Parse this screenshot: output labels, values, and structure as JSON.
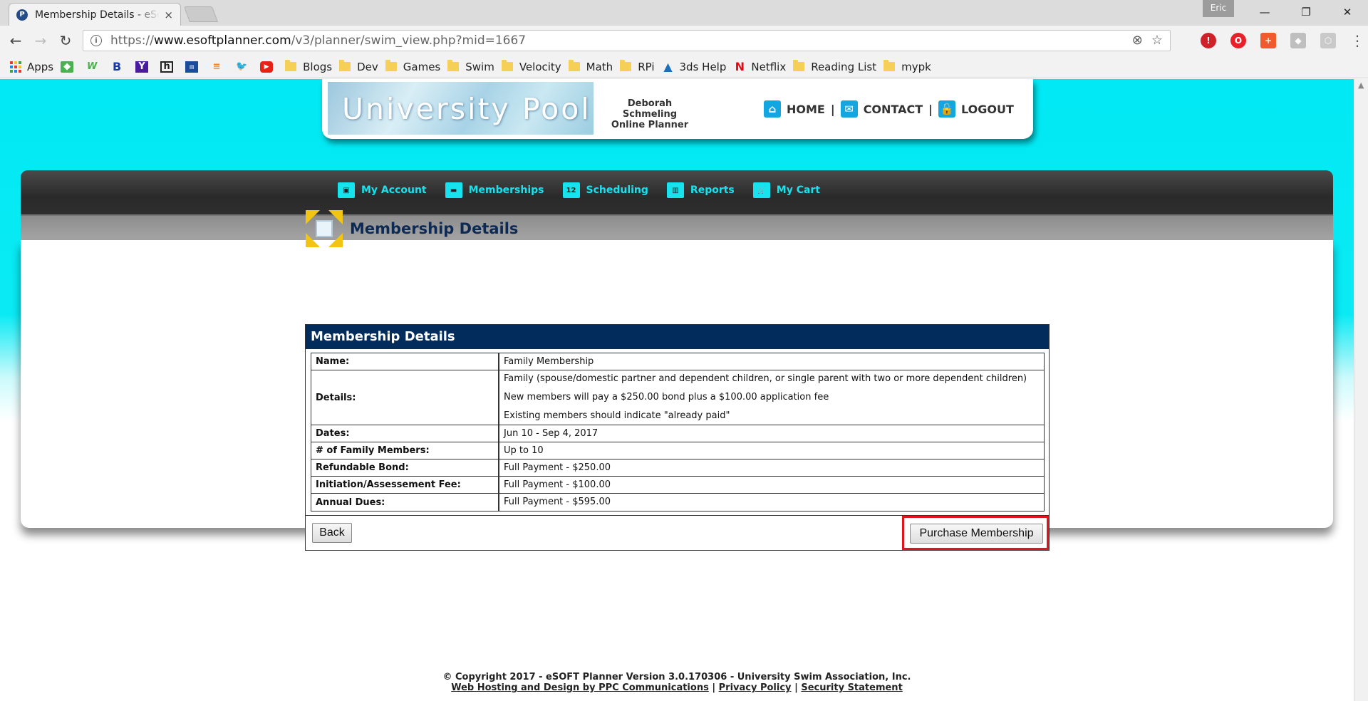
{
  "browser": {
    "tab_title": "Membership Details - eSoft Planner",
    "tab_close": "×",
    "profile_name": "Eric",
    "url_prefix": "https://",
    "url_host": "www.esoftplanner.com",
    "url_path": "/v3/planner/swim_view.php?mid=1667",
    "bookmarks": [
      "Apps",
      "Blogs",
      "Dev",
      "Games",
      "Swim",
      "Velocity",
      "Math",
      "RPi",
      "3ds Help",
      "Netflix",
      "Reading List",
      "mypk"
    ]
  },
  "header": {
    "logo_text": "University Pool",
    "planner_name": "Deborah Schmeling",
    "planner_sub": "Online Planner",
    "links": {
      "home": "HOME",
      "contact": "CONTACT",
      "logout": "LOGOUT"
    },
    "separator": "|"
  },
  "nav": {
    "items": [
      "My Account",
      "Memberships",
      "Scheduling",
      "Reports",
      "My Cart"
    ],
    "calendar_day": "12"
  },
  "main": {
    "page_title": "Membership Details",
    "table_title": "Membership Details",
    "rows": [
      {
        "label": "Name:",
        "value": [
          "Family Membership"
        ]
      },
      {
        "label": "Details:",
        "value": [
          "Family (spouse/domestic partner and dependent children, or single parent with two or more dependent children)",
          "New members will pay a $250.00 bond plus a $100.00 application fee",
          "Existing members should indicate \"already paid\""
        ]
      },
      {
        "label": "Dates:",
        "value": [
          "Jun 10 - Sep 4, 2017"
        ]
      },
      {
        "label": "# of Family Members:",
        "value": [
          "Up to 10"
        ]
      },
      {
        "label": "Refundable Bond:",
        "value": [
          "Full Payment - $250.00"
        ]
      },
      {
        "label": "Initiation/Assessement Fee:",
        "value": [
          "Full Payment - $100.00"
        ]
      },
      {
        "label": "Annual Dues:",
        "value": [
          "Full Payment - $595.00"
        ]
      }
    ],
    "back_label": "Back",
    "purchase_label": "Purchase Membership"
  },
  "footer": {
    "copyright": "© Copyright 2017 - eSOFT Planner Version 3.0.170306 - University Swim Association, Inc.",
    "links": [
      "Web Hosting and Design by PPC Communications",
      "Privacy Policy",
      "Security Statement"
    ],
    "separator": "|"
  },
  "colors": {
    "page_bg_top": "#00e9f4",
    "nav_text": "#16e3ee",
    "table_header": "#012c5b",
    "highlight": "#e0141e"
  }
}
